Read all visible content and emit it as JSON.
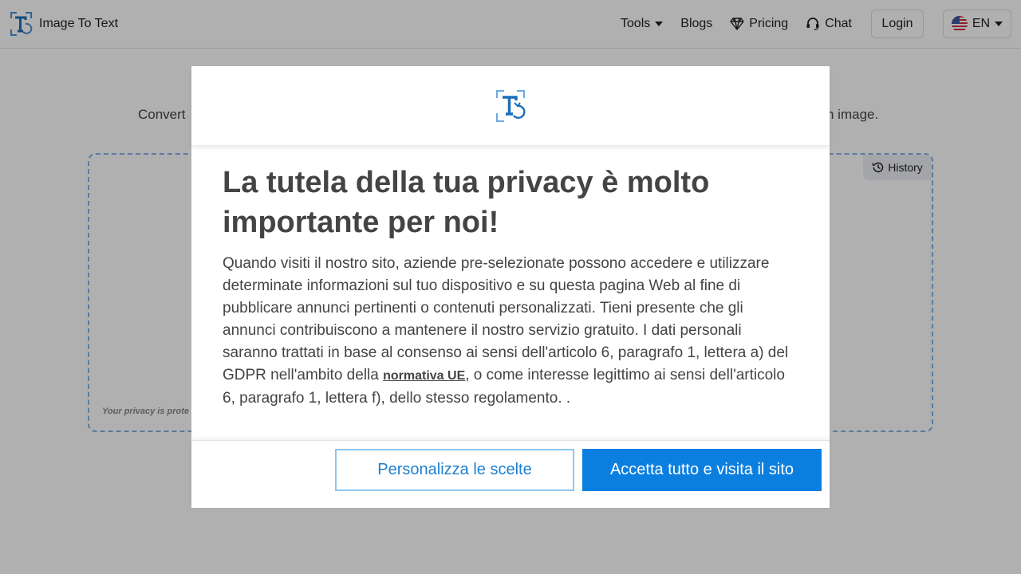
{
  "app": {
    "brand_name": "Image To Text"
  },
  "nav": {
    "tools_label": "Tools",
    "blogs_label": "Blogs",
    "pricing_label": "Pricing",
    "chat_label": "Chat",
    "login_label": "Login",
    "lang_label": "EN"
  },
  "main": {
    "subtitle_left": "Convert",
    "subtitle_right": "n image.",
    "history_label": "History",
    "privacy_note": "Your privacy is prote"
  },
  "modal": {
    "title": "La tutela della tua privacy è molto importante per noi!",
    "body_before_link": "Quando visiti il nostro sito, aziende pre-selezionate possono accedere e utilizzare determinate informazioni sul tuo dispositivo e su questa pagina Web al fine di pubblicare annunci pertinenti o contenuti personalizzati. Tieni presente che gli annunci contribuiscono a mantenere il nostro servizio gratuito. I dati personali saranno trattati in base al consenso ai sensi dell'articolo 6, paragrafo 1, lettera a) del GDPR nell'ambito della ",
    "link_text": "normativa UE",
    "body_after_link": ", o come interesse legittimo ai sensi dell'articolo 6, paragrafo 1, lettera f), dello stesso regolamento. .",
    "customize_label": "Personalizza le scelte",
    "accept_label": "Accetta tutto e visita il sito"
  },
  "colors": {
    "brand_blue": "#1d7fd0",
    "accept_button": "#0b7fe0",
    "overlay": "rgba(0,0,0,0.31)"
  },
  "icons": [
    "brand-logo-icon",
    "caret-down-icon",
    "diamond-icon",
    "headset-icon",
    "us-flag-icon",
    "history-clock-icon"
  ]
}
